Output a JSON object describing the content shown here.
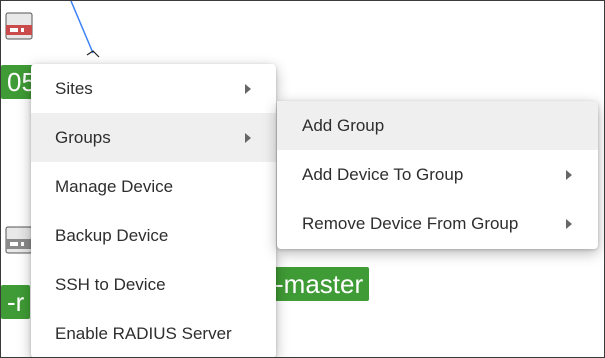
{
  "canvas": {
    "labels": {
      "top_left_fragment": "05",
      "bottom_left_fragment": "-r",
      "bottom_center": "-master"
    },
    "colors": {
      "node_label_bg": "#3f9b35",
      "link_line": "#3b82f6"
    }
  },
  "context_menu": {
    "items": [
      {
        "label": "Sites",
        "has_submenu": true
      },
      {
        "label": "Groups",
        "has_submenu": true,
        "active": true
      },
      {
        "label": "Manage Device"
      },
      {
        "label": "Backup Device"
      },
      {
        "label": "SSH to Device"
      },
      {
        "label": "Enable RADIUS Server"
      }
    ]
  },
  "groups_submenu": {
    "items": [
      {
        "label": "Add Group",
        "active": true
      },
      {
        "label": "Add Device To Group",
        "has_submenu": true
      },
      {
        "label": "Remove Device From Group",
        "has_submenu": true
      }
    ]
  },
  "icons": {
    "submenu_arrow": "chevron-right-icon",
    "device": "router-icon"
  }
}
